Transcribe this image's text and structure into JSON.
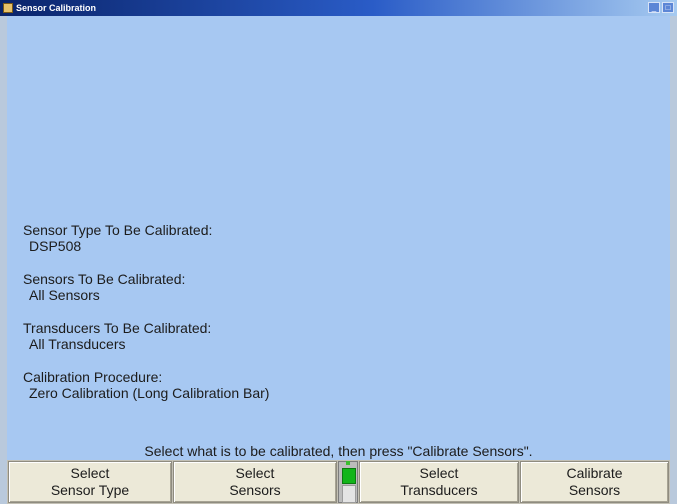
{
  "window": {
    "title": "Sensor Calibration",
    "controls": [
      "minimize-icon",
      "maximize-icon"
    ]
  },
  "info": {
    "sensor_type_label": "Sensor Type To Be Calibrated:",
    "sensor_type_value": "DSP508",
    "sensors_label": "Sensors To Be Calibrated:",
    "sensors_value": "All Sensors",
    "transducers_label": "Transducers To Be Calibrated:",
    "transducers_value": "All Transducers",
    "procedure_label": "Calibration Procedure:",
    "procedure_value": "Zero Calibration (Long Calibration Bar)"
  },
  "instruction": "Select what is to be calibrated, then press \"Calibrate Sensors\".",
  "buttons": [
    {
      "line1": "Select",
      "line2": "Sensor Type"
    },
    {
      "line1": "Select",
      "line2": "Sensors"
    },
    {
      "line1": "Select",
      "line2": "Transducers"
    },
    {
      "line1": "Calibrate",
      "line2": "Sensors"
    }
  ],
  "colors": {
    "client_bg": "#a7c8f2",
    "title_bar": "#0a246a",
    "button_face": "#ece9d8",
    "indicator_green": "#12b51a"
  }
}
